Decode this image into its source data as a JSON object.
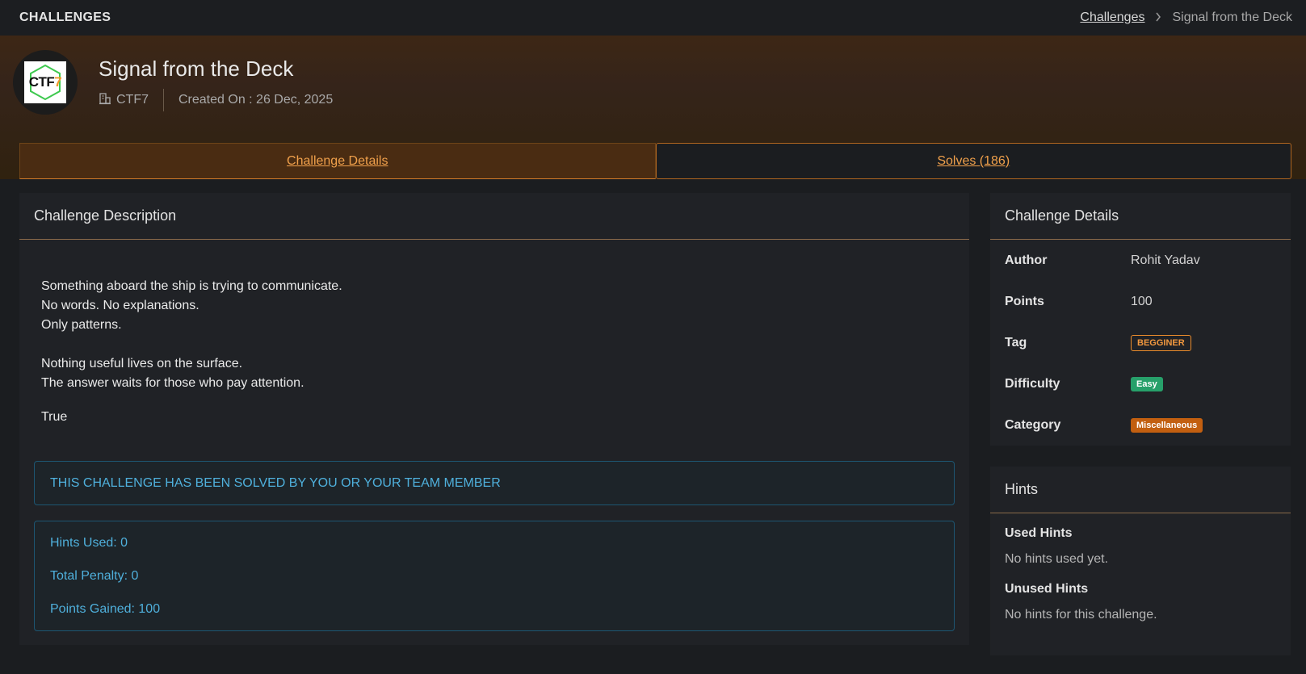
{
  "topbar": {
    "title": "CHALLENGES",
    "breadcrumb_link": "Challenges",
    "breadcrumb_current": "Signal from the Deck"
  },
  "challenge": {
    "logo_text": "CTF",
    "logo_accent": "7",
    "title": "Signal from the Deck",
    "org": "CTF7",
    "created": "Created On : 26 Dec, 2025"
  },
  "tabs": [
    {
      "label": "Challenge Details",
      "active": true
    },
    {
      "label": "Solves (186)",
      "active": false
    }
  ],
  "description": {
    "header": "Challenge Description",
    "lines_1": [
      "Something aboard the ship is trying to communicate.",
      "No words. No explanations.",
      "Only patterns."
    ],
    "lines_2": [
      "Nothing useful lives on the surface.",
      "The answer waits for those who pay attention."
    ],
    "trailing": "True",
    "solved_notice": "THIS CHALLENGE HAS BEEN SOLVED BY YOU OR YOUR TEAM MEMBER",
    "stats": [
      "Hints Used: 0",
      "Total Penalty: 0",
      "Points Gained: 100"
    ]
  },
  "details": {
    "header": "Challenge Details",
    "rows": [
      {
        "label": "Author",
        "value": "Rohit Yadav"
      },
      {
        "label": "Points",
        "value": "100"
      },
      {
        "label": "Tag",
        "value": "BEGGINER"
      },
      {
        "label": "Difficulty",
        "value": "Easy"
      },
      {
        "label": "Category",
        "value": "Miscellaneous"
      }
    ]
  },
  "hints": {
    "header": "Hints",
    "used_title": "Used Hints",
    "used_text": "No hints used yet.",
    "unused_title": "Unused Hints",
    "unused_text": "No hints for this challenge."
  },
  "colors": {
    "accent": "#f0a04b",
    "info": "#4fb0dc",
    "easy": "#27a06a",
    "category": "#c25f10"
  }
}
